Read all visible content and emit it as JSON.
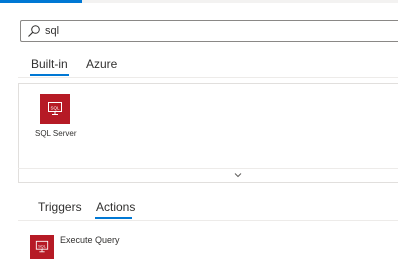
{
  "search": {
    "value": "sql",
    "icon": "search-icon"
  },
  "source_tabs": [
    {
      "label": "Built-in",
      "selected": true
    },
    {
      "label": "Azure",
      "selected": false
    }
  ],
  "connectors": [
    {
      "label": "SQL Server",
      "icon": "sql-server-icon",
      "icon_text": "SQL",
      "color": "#b61a25"
    }
  ],
  "result_tabs": [
    {
      "label": "Triggers",
      "selected": false
    },
    {
      "label": "Actions",
      "selected": true
    }
  ],
  "actions": [
    {
      "label": "Execute Query",
      "icon": "sql-server-icon",
      "icon_text": "SQL"
    }
  ],
  "colors": {
    "accent": "#0078d4",
    "sql_brand": "#b61a25"
  }
}
